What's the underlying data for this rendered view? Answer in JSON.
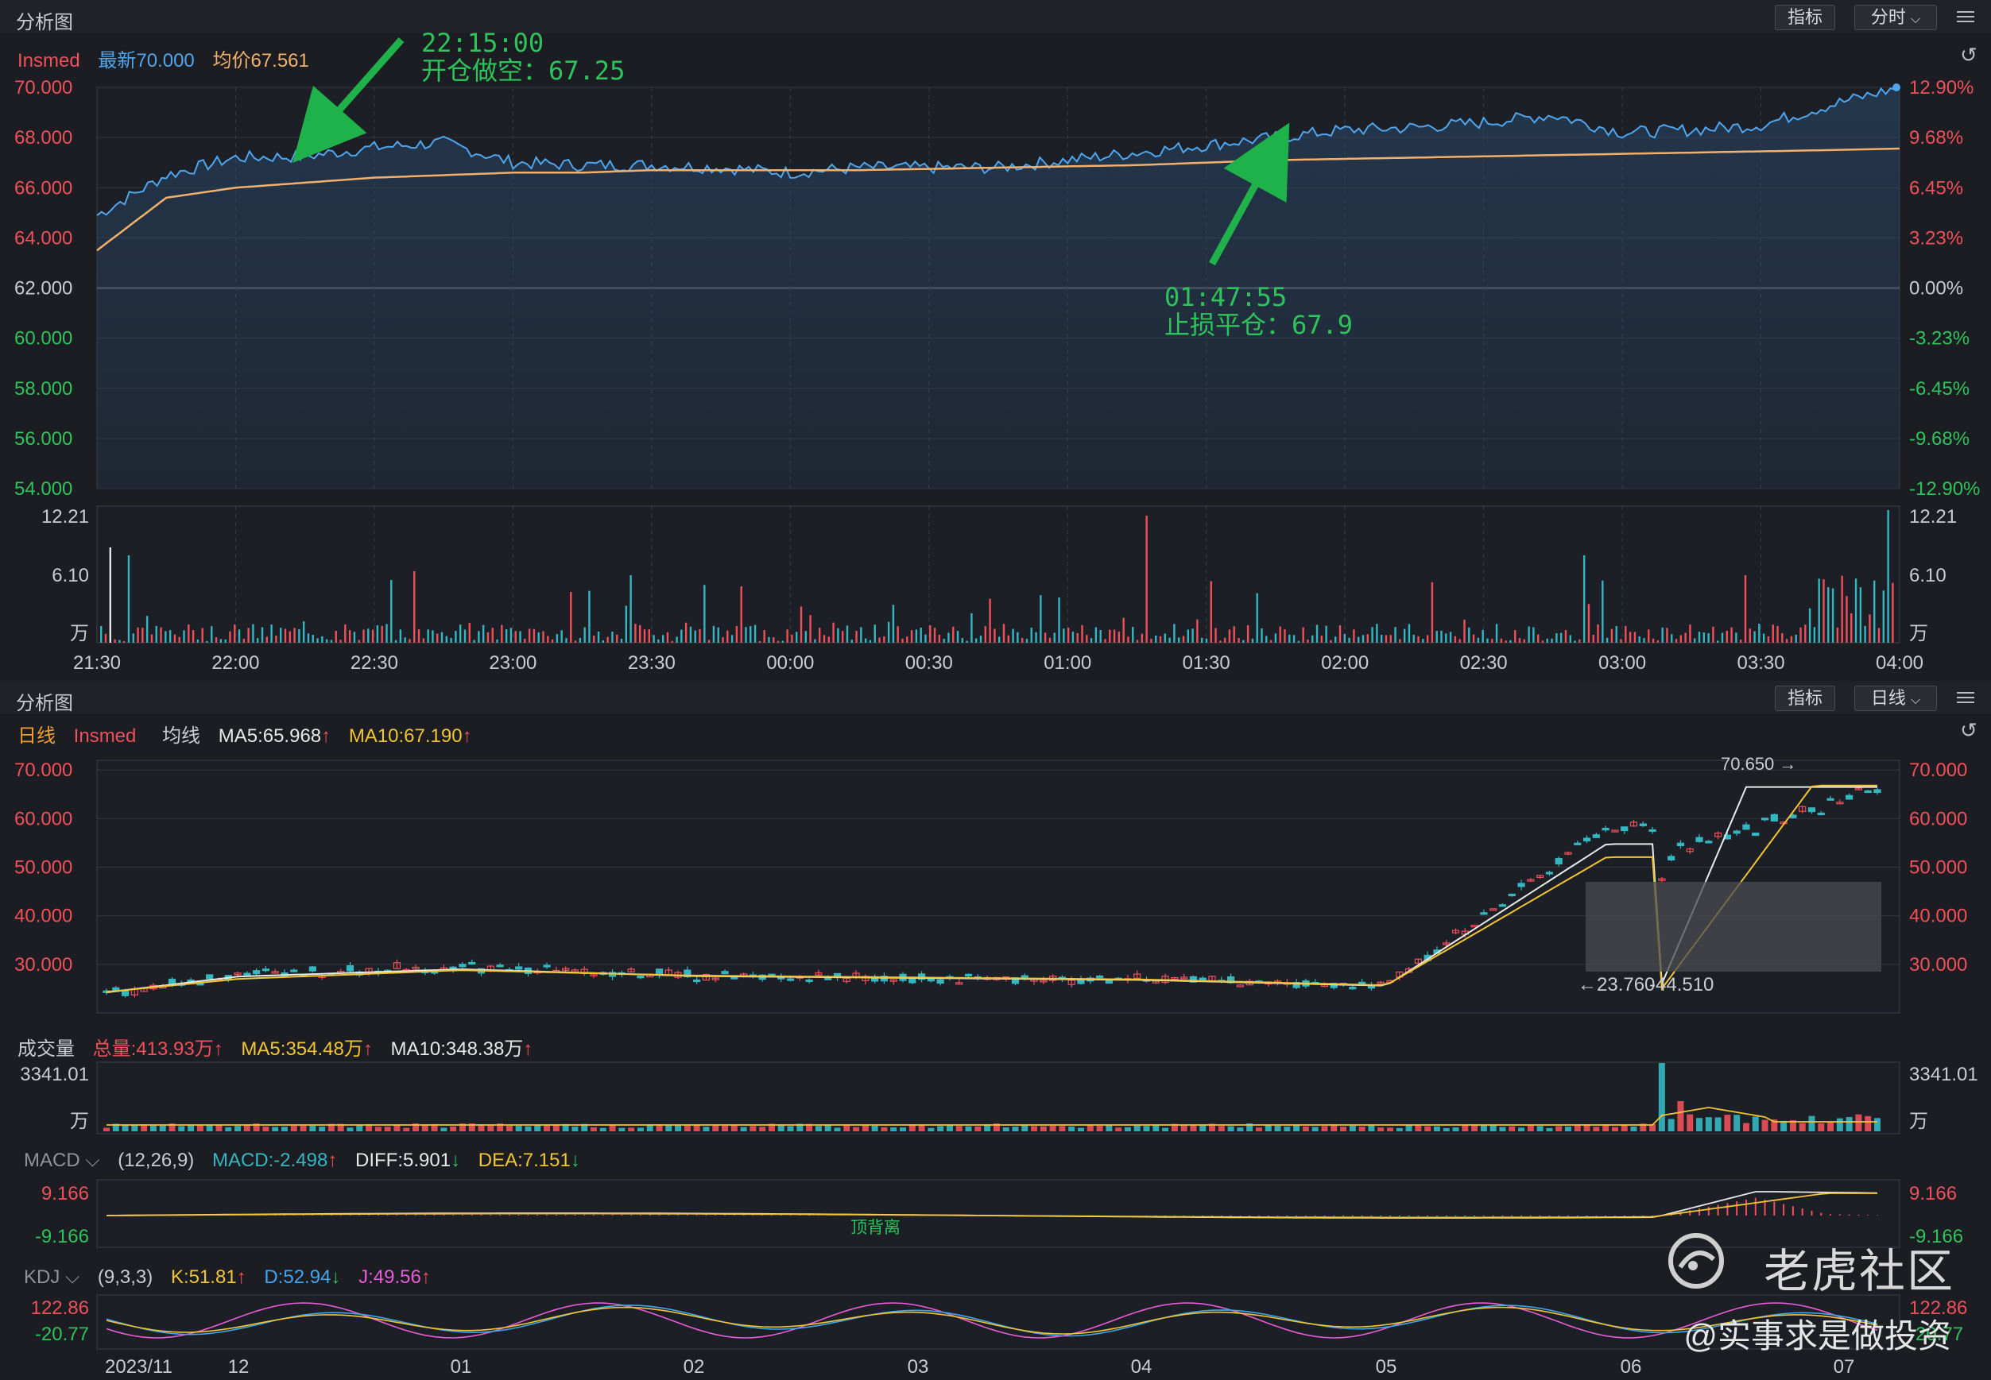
{
  "intraday": {
    "panel_title": "分析图",
    "btn_indicator": "指标",
    "btn_period": "分时",
    "legend": {
      "name": "Insmed",
      "latest": "最新70.000",
      "avg": "均价67.561"
    },
    "left_ticks": [
      "70.000",
      "68.000",
      "66.000",
      "64.000",
      "62.000",
      "60.000",
      "58.000",
      "56.000",
      "54.000"
    ],
    "right_ticks": [
      "12.90%",
      "9.68%",
      "6.45%",
      "3.23%",
      "0.00%",
      "-3.23%",
      "-6.45%",
      "-9.68%",
      "-12.90%"
    ],
    "vol_ticks_left": [
      "12.21",
      "6.10",
      "万"
    ],
    "vol_ticks_right": [
      "12.21",
      "6.10",
      "万"
    ],
    "time_ticks": [
      "21:30",
      "22:00",
      "22:30",
      "23:00",
      "23:30",
      "00:00",
      "00:30",
      "01:00",
      "01:30",
      "02:00",
      "02:30",
      "03:00",
      "03:30",
      "04:00"
    ],
    "annotation1": {
      "time": "22:15:00",
      "text": "开仓做空：67.25"
    },
    "annotation2": {
      "time": "01:47:55",
      "text": "止损平仓：67.9"
    }
  },
  "daily": {
    "panel_title": "分析图",
    "btn_indicator": "指标",
    "btn_period": "日线",
    "legend": {
      "type": "日线",
      "name": "Insmed",
      "ma_label": "均线",
      "ma5": "MA5:65.968",
      "ma10": "MA10:67.190"
    },
    "left_ticks": [
      "70.000",
      "60.000",
      "50.000",
      "40.000",
      "30.000"
    ],
    "right_ticks": [
      "70.000",
      "60.000",
      "50.000",
      "40.000",
      "30.000"
    ],
    "high_label": "70.650",
    "range_label": "23.760",
    "pct_label": "-44.510",
    "volume": {
      "title": "成交量",
      "total": "总量:413.93万",
      "ma5": "MA5:354.48万",
      "ma10": "MA10:348.38万",
      "tick_left": [
        "3341.01",
        "万"
      ],
      "tick_right": [
        "3341.01",
        "万"
      ]
    },
    "macd": {
      "title": "MACD",
      "params": "(12,26,9)",
      "macd": "MACD:-2.498",
      "diff": "DIFF:5.901",
      "dea": "DEA:7.151",
      "tick_left": [
        "9.166",
        "-9.166"
      ],
      "tick_right": [
        "9.166",
        "-9.166"
      ],
      "note": "顶背离"
    },
    "kdj": {
      "title": "KDJ",
      "params": "(9,3,3)",
      "k": "K:51.81",
      "d": "D:52.94",
      "j": "J:49.56",
      "tick_left": [
        "122.86",
        "-20.77"
      ],
      "tick_right": [
        "122.86",
        "-20.77"
      ]
    },
    "date_ticks": [
      "2023/11",
      "12",
      "01",
      "02",
      "03",
      "04",
      "05",
      "06",
      "07"
    ]
  },
  "watermark": {
    "brand": "老虎社区",
    "user": "@实事求是做投资"
  },
  "chart_data": [
    {
      "type": "line",
      "title": "",
      "series": [
        {
          "name": "最新",
          "x": [
            "21:30",
            "21:45",
            "22:00",
            "22:15",
            "22:30",
            "22:45",
            "23:00",
            "23:15",
            "23:30",
            "23:45",
            "00:00",
            "00:15",
            "00:30",
            "00:45",
            "01:00",
            "01:15",
            "01:30",
            "01:45",
            "02:00",
            "02:15",
            "02:30",
            "02:45",
            "03:00",
            "03:15",
            "03:30",
            "03:45",
            "04:00"
          ],
          "y": [
            64.9,
            66.5,
            67.2,
            67.25,
            67.6,
            67.8,
            67.0,
            66.9,
            66.9,
            66.8,
            66.6,
            66.8,
            66.8,
            66.8,
            67.1,
            67.4,
            67.7,
            68.0,
            68.3,
            68.4,
            68.6,
            68.9,
            68.2,
            68.3,
            68.5,
            69.3,
            70.0
          ]
        },
        {
          "name": "均价",
          "x": [
            "21:30",
            "21:45",
            "22:00",
            "22:15",
            "22:30",
            "22:45",
            "23:00",
            "23:15",
            "23:30",
            "23:45",
            "00:00",
            "00:15",
            "00:30",
            "00:45",
            "01:00",
            "01:15",
            "01:30",
            "01:45",
            "02:00",
            "02:15",
            "02:30",
            "02:45",
            "03:00",
            "03:15",
            "03:30",
            "03:45",
            "04:00"
          ],
          "y": [
            63.5,
            65.6,
            66.0,
            66.2,
            66.4,
            66.5,
            66.6,
            66.6,
            66.7,
            66.7,
            66.7,
            66.7,
            66.75,
            66.8,
            66.85,
            66.9,
            67.0,
            67.1,
            67.15,
            67.2,
            67.25,
            67.3,
            67.35,
            67.4,
            67.45,
            67.5,
            67.561
          ]
        }
      ],
      "ylim": [
        54,
        70
      ],
      "annotations": [
        {
          "x": "22:15",
          "y": 67.25,
          "text": "开仓做空：67.25"
        },
        {
          "x": "01:47",
          "y": 67.9,
          "text": "止损平仓：67.9"
        }
      ]
    },
    {
      "type": "line",
      "title": "",
      "series": [
        {
          "name": "Insmed",
          "x": [
            "2023/11",
            "12",
            "01",
            "02",
            "03",
            "04",
            "05",
            "06",
            "07"
          ],
          "y": [
            24.0,
            28.0,
            29.5,
            27.5,
            27.0,
            27.0,
            25.5,
            62.0,
            67.0
          ]
        },
        {
          "name": "MA5",
          "x": [
            "2023/11",
            "12",
            "01",
            "02",
            "03",
            "04",
            "05",
            "06",
            "07"
          ],
          "y": [
            24.2,
            27.5,
            29.0,
            27.6,
            27.2,
            26.8,
            25.6,
            58.0,
            65.968
          ]
        },
        {
          "name": "MA10",
          "x": [
            "2023/11",
            "12",
            "01",
            "02",
            "03",
            "04",
            "05",
            "06",
            "07"
          ],
          "y": [
            24.3,
            27.0,
            28.8,
            27.7,
            27.3,
            26.9,
            25.7,
            55.0,
            67.19
          ]
        }
      ],
      "ylim": [
        20,
        72
      ]
    }
  ]
}
